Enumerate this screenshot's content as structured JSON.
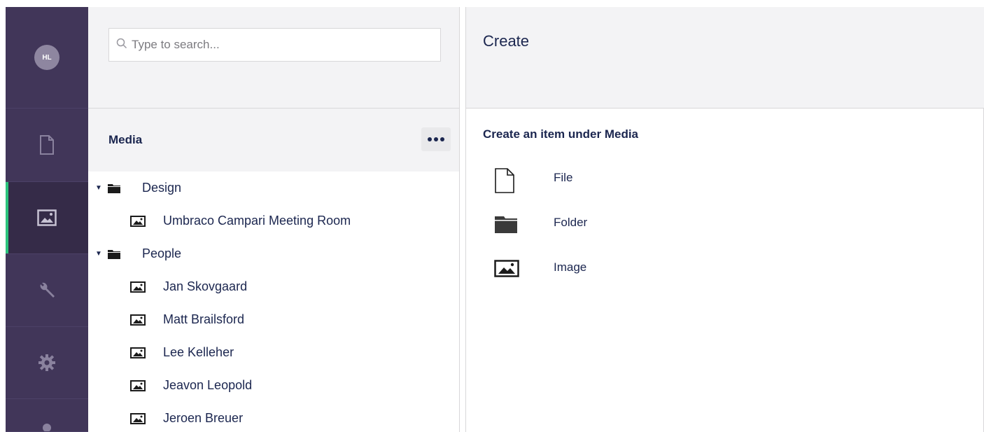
{
  "user": {
    "initials": "HL"
  },
  "rail": {
    "sections": [
      {
        "name": "content",
        "icon": "document-icon",
        "active": false
      },
      {
        "name": "media",
        "icon": "image-icon",
        "active": true
      },
      {
        "name": "settings-tools",
        "icon": "wrench-icon",
        "active": false
      },
      {
        "name": "settings",
        "icon": "gear-icon",
        "active": false
      },
      {
        "name": "users",
        "icon": "user-icon",
        "active": false
      }
    ]
  },
  "search": {
    "placeholder": "Type to search..."
  },
  "tree": {
    "title": "Media",
    "items": [
      {
        "label": "Design",
        "type": "folder",
        "expanded": true,
        "level": 0
      },
      {
        "label": "Umbraco Campari Meeting Room",
        "type": "image",
        "level": 1
      },
      {
        "label": "People",
        "type": "folder",
        "expanded": true,
        "level": 0
      },
      {
        "label": "Jan Skovgaard",
        "type": "image",
        "level": 1
      },
      {
        "label": "Matt Brailsford",
        "type": "image",
        "level": 1
      },
      {
        "label": "Lee Kelleher",
        "type": "image",
        "level": 1
      },
      {
        "label": "Jeavon Leopold",
        "type": "image",
        "level": 1
      },
      {
        "label": "Jeroen Breuer",
        "type": "image",
        "level": 1
      }
    ]
  },
  "panel": {
    "title": "Create",
    "subtitle": "Create an item under Media",
    "options": [
      {
        "label": "File",
        "icon": "file-icon"
      },
      {
        "label": "Folder",
        "icon": "folder-icon"
      },
      {
        "label": "Image",
        "icon": "image-icon"
      }
    ]
  },
  "colors": {
    "rail_bg": "#413659",
    "rail_active_bg": "#352b48",
    "rail_active_indicator": "#2bc37c",
    "panel_header_bg": "#f3f3f5",
    "text": "#1b264f"
  }
}
